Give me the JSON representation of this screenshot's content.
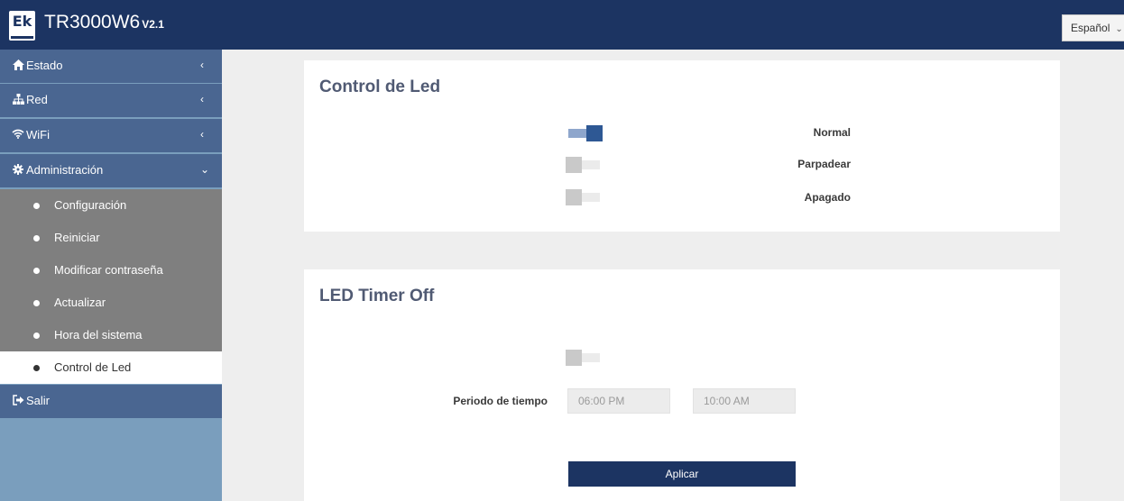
{
  "header": {
    "logo_text": "Ek",
    "title": "TR3000W6",
    "version": "V2.1",
    "language": "Español"
  },
  "sidebar": {
    "items": [
      {
        "label": "Estado",
        "icon": "home-icon"
      },
      {
        "label": "Red",
        "icon": "sitemap-icon"
      },
      {
        "label": "WiFi",
        "icon": "wifi-icon"
      },
      {
        "label": "Administración",
        "icon": "gear-icon"
      },
      {
        "label": "Salir",
        "icon": "sign-out-icon"
      }
    ],
    "subitems": [
      {
        "label": "Configuración"
      },
      {
        "label": "Reiniciar"
      },
      {
        "label": "Modificar contraseña"
      },
      {
        "label": "Actualizar"
      },
      {
        "label": "Hora del sistema"
      },
      {
        "label": "Control de Led",
        "active": true
      }
    ]
  },
  "led_control": {
    "title": "Control de Led",
    "options": [
      {
        "label": "Normal",
        "on": true
      },
      {
        "label": "Parpadear",
        "on": false
      },
      {
        "label": "Apagado",
        "on": false
      }
    ]
  },
  "led_timer": {
    "title": "LED Timer Off",
    "enabled": false,
    "period_label": "Periodo de tiempo",
    "start_time": "06:00 PM",
    "end_time": "10:00 AM",
    "apply_label": "Aplicar"
  },
  "colors": {
    "header": "#1c3462",
    "nav": "#4a6691",
    "submenu": "#7f7f7f",
    "toggle_on": "#2e5894",
    "toggle_off": "#c9c9c9"
  }
}
